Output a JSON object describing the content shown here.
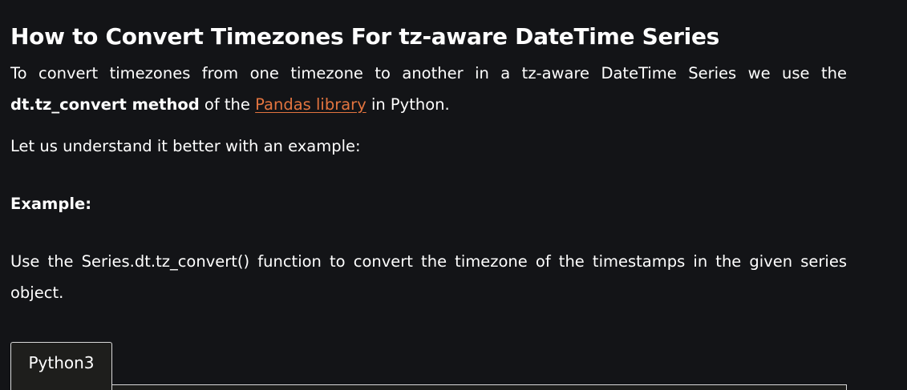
{
  "article": {
    "title": "How to Convert Timezones For tz-aware DateTime Series",
    "intro": {
      "text_before": "To convert timezones from one timezone to another in a tz-aware DateTime Series we use the ",
      "method_name": "dt.tz_convert method",
      "text_middle": " of the ",
      "link_text": "Pandas library",
      "text_after": " in Python."
    },
    "lead_in": "Let us understand it better with an example:",
    "example_heading": "Example:",
    "example_description": "Use the Series.dt.tz_convert() function to convert the timezone of the timestamps in the given series object."
  },
  "code_block": {
    "tabs": [
      "Python3"
    ]
  },
  "colors": {
    "background": "#131417",
    "text": "#ffffff",
    "link": "#e2743f",
    "code_background": "#1e1e1c"
  }
}
